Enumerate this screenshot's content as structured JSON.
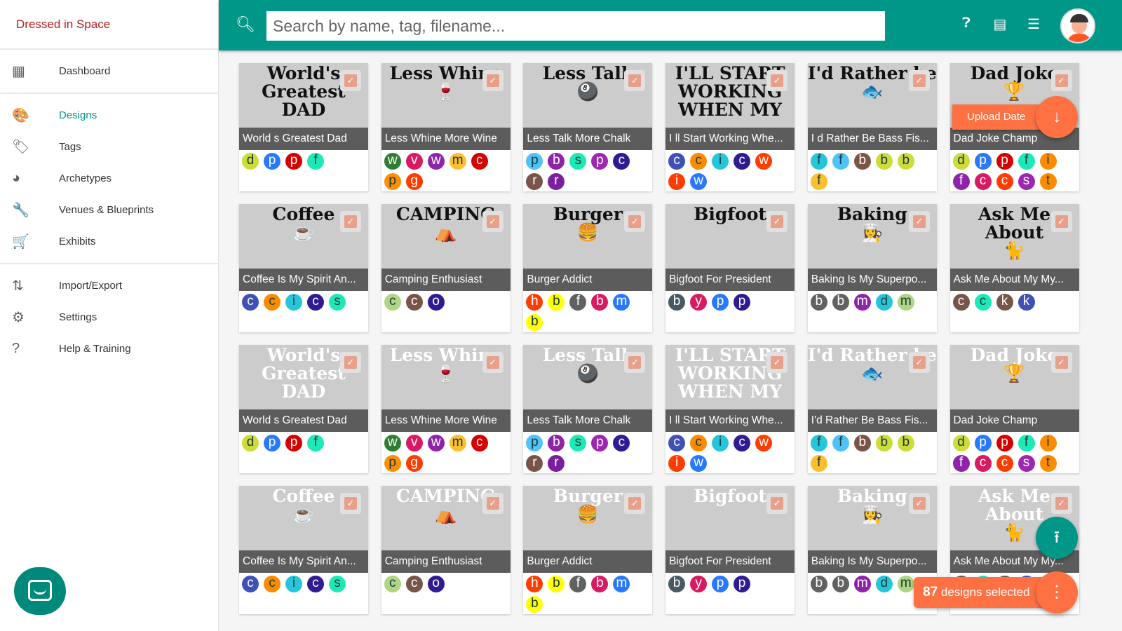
{
  "app": {
    "brand": "Dressed in Space"
  },
  "sidebar": {
    "sections": [
      [
        {
          "label": "Dashboard",
          "icon": "dashboard-icon",
          "glyph": "▦"
        }
      ],
      [
        {
          "label": "Designs",
          "icon": "palette-icon",
          "glyph": "🎨",
          "active": true
        },
        {
          "label": "Tags",
          "icon": "tag-icon",
          "glyph": "🏷"
        },
        {
          "label": "Archetypes",
          "icon": "archetypes-icon",
          "glyph": "◕"
        },
        {
          "label": "Venues & Blueprints",
          "icon": "wrench-icon",
          "glyph": "🔧"
        },
        {
          "label": "Exhibits",
          "icon": "cart-icon",
          "glyph": "🛒"
        }
      ],
      [
        {
          "label": "Import/Export",
          "icon": "import-export-icon",
          "glyph": "⇅"
        },
        {
          "label": "Settings",
          "icon": "gear-icon",
          "glyph": "⚙"
        },
        {
          "label": "Help & Training",
          "icon": "help-icon",
          "glyph": "?"
        }
      ]
    ]
  },
  "header": {
    "search_placeholder": "Search by name, tag, filename...",
    "accent": "#009688"
  },
  "sort": {
    "label": "Upload Date"
  },
  "selection": {
    "count": "87",
    "label": "designs selected"
  },
  "designs": [
    {
      "title": "World s Greatest Dad",
      "art": "World's\nGreatest\nDAD",
      "tags": [
        [
          "d",
          "#cddc39"
        ],
        [
          "p",
          "#2979ff"
        ],
        [
          "p",
          "#d50000"
        ],
        [
          "f",
          "#1de9b6"
        ]
      ]
    },
    {
      "title": "Less Whine More Wine",
      "art": "Less Whine\n🍷",
      "tags": [
        [
          "w",
          "#2e7d32"
        ],
        [
          "v",
          "#d81b60"
        ],
        [
          "w",
          "#8e24aa"
        ],
        [
          "m",
          "#fbc02d"
        ],
        [
          "c",
          "#d50000"
        ],
        [
          "p",
          "#ff8f00"
        ],
        [
          "g",
          "#ff3d00"
        ]
      ]
    },
    {
      "title": "Less Talk More Chalk",
      "art": "Less Talk\n🎱",
      "tags": [
        [
          "p",
          "#4fc3f7"
        ],
        [
          "b",
          "#8e24aa"
        ],
        [
          "s",
          "#1de9b6"
        ],
        [
          "p",
          "#9c27b0"
        ],
        [
          "c",
          "#311b92"
        ],
        [
          "r",
          "#795548"
        ],
        [
          "r",
          "#7b1fa2"
        ]
      ]
    },
    {
      "title": "I ll Start Working Whe...",
      "art": "I'LL START\nWORKING\nWHEN MY",
      "tags": [
        [
          "c",
          "#3f51b5"
        ],
        [
          "c",
          "#fb8c00"
        ],
        [
          "i",
          "#26c6da"
        ],
        [
          "c",
          "#311b92"
        ],
        [
          "w",
          "#ff3d00"
        ],
        [
          "i",
          "#ff3d00"
        ],
        [
          "w",
          "#2979ff"
        ]
      ]
    },
    {
      "title": "I d Rather Be Bass Fis...",
      "art": "I'd Rather be\n🐟",
      "tags": [
        [
          "f",
          "#26c6da"
        ],
        [
          "f",
          "#4fc3f7"
        ],
        [
          "b",
          "#795548"
        ],
        [
          "b",
          "#cddc39"
        ],
        [
          "b",
          "#cddc39"
        ],
        [
          "f",
          "#fbc02d"
        ]
      ]
    },
    {
      "title": "Dad Joke Champ",
      "art": "Dad Joke\n🏆",
      "tags": [
        [
          "d",
          "#cddc39"
        ],
        [
          "p",
          "#2979ff"
        ],
        [
          "p",
          "#d50000"
        ],
        [
          "f",
          "#1de9b6"
        ],
        [
          "i",
          "#fb8c00"
        ],
        [
          "f",
          "#8e24aa"
        ],
        [
          "c",
          "#d81b60"
        ],
        [
          "c",
          "#ff3d00"
        ],
        [
          "s",
          "#9c27b0"
        ],
        [
          "t",
          "#fb8c00"
        ]
      ]
    },
    {
      "title": "Coffee Is My Spirit An...",
      "art": "Coffee\n☕",
      "tags": [
        [
          "c",
          "#3f51b5"
        ],
        [
          "c",
          "#fb8c00"
        ],
        [
          "i",
          "#26c6da"
        ],
        [
          "c",
          "#311b92"
        ],
        [
          "s",
          "#1de9b6"
        ]
      ]
    },
    {
      "title": "Camping Enthusiast",
      "art": "CAMPING\n⛺",
      "tags": [
        [
          "c",
          "#aed581"
        ],
        [
          "c",
          "#795548"
        ],
        [
          "o",
          "#311b92"
        ]
      ]
    },
    {
      "title": "Burger Addict",
      "art": "Burger\n🍔",
      "tags": [
        [
          "h",
          "#ff3d00"
        ],
        [
          "b",
          "#ffff00"
        ],
        [
          "f",
          "#616161"
        ],
        [
          "b",
          "#d81b60"
        ],
        [
          "m",
          "#2979ff"
        ],
        [
          "b",
          "#ffff00"
        ]
      ]
    },
    {
      "title": "Bigfoot For President",
      "art": "Bigfoot",
      "tags": [
        [
          "b",
          "#455a64"
        ],
        [
          "y",
          "#d81b60"
        ],
        [
          "p",
          "#2979ff"
        ],
        [
          "p",
          "#311b92"
        ]
      ]
    },
    {
      "title": "Baking Is My Superpo...",
      "art": "Baking\n👩‍🍳",
      "tags": [
        [
          "b",
          "#616161"
        ],
        [
          "b",
          "#616161"
        ],
        [
          "m",
          "#8e24aa"
        ],
        [
          "d",
          "#26c6da"
        ],
        [
          "m",
          "#aed581"
        ]
      ]
    },
    {
      "title": "Ask Me About My My...",
      "art": "Ask Me About\n🐈",
      "tags": [
        [
          "c",
          "#795548"
        ],
        [
          "c",
          "#1de9b6"
        ],
        [
          "k",
          "#795548"
        ],
        [
          "k",
          "#3f51b5"
        ]
      ]
    },
    {
      "title": "World s Greatest Dad",
      "art": "World's\nGreatest\nDAD",
      "light": true,
      "tags": [
        [
          "d",
          "#cddc39"
        ],
        [
          "p",
          "#2979ff"
        ],
        [
          "p",
          "#d50000"
        ],
        [
          "f",
          "#1de9b6"
        ]
      ]
    },
    {
      "title": "Less Whine More Wine",
      "art": "Less Whine\n🍷",
      "light": true,
      "tags": [
        [
          "w",
          "#2e7d32"
        ],
        [
          "v",
          "#d81b60"
        ],
        [
          "w",
          "#8e24aa"
        ],
        [
          "m",
          "#fbc02d"
        ],
        [
          "c",
          "#d50000"
        ],
        [
          "p",
          "#ff8f00"
        ],
        [
          "g",
          "#ff3d00"
        ]
      ]
    },
    {
      "title": "Less Talk More Chalk",
      "art": "Less Talk\n🎱",
      "light": true,
      "tags": [
        [
          "p",
          "#4fc3f7"
        ],
        [
          "b",
          "#8e24aa"
        ],
        [
          "s",
          "#1de9b6"
        ],
        [
          "p",
          "#9c27b0"
        ],
        [
          "c",
          "#311b92"
        ],
        [
          "r",
          "#795548"
        ],
        [
          "r",
          "#7b1fa2"
        ]
      ]
    },
    {
      "title": "I ll Start Working Whe...",
      "art": "I'LL START\nWORKING\nWHEN MY",
      "light": true,
      "tags": [
        [
          "c",
          "#3f51b5"
        ],
        [
          "c",
          "#fb8c00"
        ],
        [
          "i",
          "#26c6da"
        ],
        [
          "c",
          "#311b92"
        ],
        [
          "w",
          "#ff3d00"
        ],
        [
          "i",
          "#ff3d00"
        ],
        [
          "w",
          "#2979ff"
        ]
      ]
    },
    {
      "title": "I'd Rather Be Bass Fis...",
      "art": "I'd Rather be\n🐟",
      "light": true,
      "tags": [
        [
          "f",
          "#26c6da"
        ],
        [
          "f",
          "#4fc3f7"
        ],
        [
          "b",
          "#795548"
        ],
        [
          "b",
          "#cddc39"
        ],
        [
          "b",
          "#cddc39"
        ],
        [
          "f",
          "#fbc02d"
        ]
      ]
    },
    {
      "title": "Dad Joke Champ",
      "art": "Dad Joke\n🏆",
      "light": true,
      "tags": [
        [
          "d",
          "#cddc39"
        ],
        [
          "p",
          "#2979ff"
        ],
        [
          "p",
          "#d50000"
        ],
        [
          "f",
          "#1de9b6"
        ],
        [
          "i",
          "#fb8c00"
        ],
        [
          "f",
          "#8e24aa"
        ],
        [
          "c",
          "#d81b60"
        ],
        [
          "c",
          "#ff3d00"
        ],
        [
          "s",
          "#9c27b0"
        ],
        [
          "t",
          "#fb8c00"
        ]
      ]
    },
    {
      "title": "Coffee Is My Spirit An...",
      "art": "Coffee\n☕",
      "light": true,
      "tags": [
        [
          "c",
          "#3f51b5"
        ],
        [
          "c",
          "#fb8c00"
        ],
        [
          "i",
          "#26c6da"
        ],
        [
          "c",
          "#311b92"
        ],
        [
          "s",
          "#1de9b6"
        ]
      ]
    },
    {
      "title": "Camping Enthusiast",
      "art": "CAMPING\n⛺",
      "light": true,
      "tags": [
        [
          "c",
          "#aed581"
        ],
        [
          "c",
          "#795548"
        ],
        [
          "o",
          "#311b92"
        ]
      ]
    },
    {
      "title": "Burger Addict",
      "art": "Burger\n🍔",
      "light": true,
      "tags": [
        [
          "h",
          "#ff3d00"
        ],
        [
          "b",
          "#ffff00"
        ],
        [
          "f",
          "#616161"
        ],
        [
          "b",
          "#d81b60"
        ],
        [
          "m",
          "#2979ff"
        ],
        [
          "b",
          "#ffff00"
        ]
      ]
    },
    {
      "title": "Bigfoot For President",
      "art": "Bigfoot",
      "light": true,
      "tags": [
        [
          "b",
          "#455a64"
        ],
        [
          "y",
          "#d81b60"
        ],
        [
          "p",
          "#2979ff"
        ],
        [
          "p",
          "#311b92"
        ]
      ]
    },
    {
      "title": "Baking Is My Superpo...",
      "art": "Baking\n👩‍🍳",
      "light": true,
      "tags": [
        [
          "b",
          "#616161"
        ],
        [
          "b",
          "#616161"
        ],
        [
          "m",
          "#8e24aa"
        ],
        [
          "d",
          "#26c6da"
        ],
        [
          "m",
          "#aed581"
        ]
      ]
    },
    {
      "title": "Ask Me About My My...",
      "art": "Ask Me About\n🐈",
      "light": true,
      "tags": [
        [
          "c",
          "#795548"
        ],
        [
          "c",
          "#1de9b6"
        ],
        [
          "k",
          "#795548"
        ],
        [
          "k",
          "#3f51b5"
        ]
      ]
    }
  ]
}
